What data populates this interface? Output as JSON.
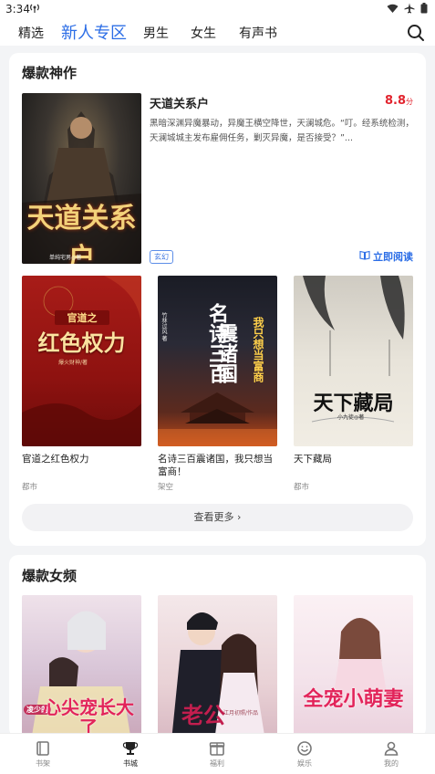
{
  "status": {
    "time": "3:34"
  },
  "tabs": [
    {
      "label": "精选"
    },
    {
      "label": "新人专区"
    },
    {
      "label": "男生"
    },
    {
      "label": "女生"
    },
    {
      "label": "有声书"
    }
  ],
  "section1": {
    "title": "爆款神作",
    "featured": {
      "title": "天道关系户",
      "score": "8.8",
      "score_unit": "分",
      "desc": "黑暗深渊异魔暴动，异魔王横空降世，天澜城危。“叮。经系统检测，天澜城城主发布雇佣任务，剿灭异魔，是否接受？”...",
      "tag": "玄幻",
      "read_label": "立即阅读",
      "cover_text": "天道关系户",
      "cover_author": "单纯宅男◎著"
    },
    "books": [
      {
        "title": "官道之红色权力",
        "category": "都市",
        "cover_line1": "官道之",
        "cover_line2": "红色权力",
        "cover_author": "爆火财神/著"
      },
      {
        "title": "名诗三百震诸国，我只想当富商！",
        "category": "架空",
        "cover_line1": "名诗三百",
        "cover_line2": "震诸国",
        "cover_side": "我只想当富商",
        "cover_author": "竹林过风 著"
      },
      {
        "title": "天下藏局",
        "category": "都市",
        "cover_line1": "天下藏局",
        "cover_author": "小九徒◎著"
      }
    ],
    "more_label": "查看更多"
  },
  "section2": {
    "title": "爆款女频",
    "covers": [
      {
        "text": "心尖宠长大了",
        "sub": "凌少的"
      },
      {
        "text": "老公",
        "sub": "江月初照/作品"
      },
      {
        "text": "全宠小萌妻",
        "sub": ""
      }
    ]
  },
  "bottom_nav": [
    {
      "label": "书架"
    },
    {
      "label": "书城"
    },
    {
      "label": "福利"
    },
    {
      "label": "娱乐"
    },
    {
      "label": "我的"
    }
  ]
}
